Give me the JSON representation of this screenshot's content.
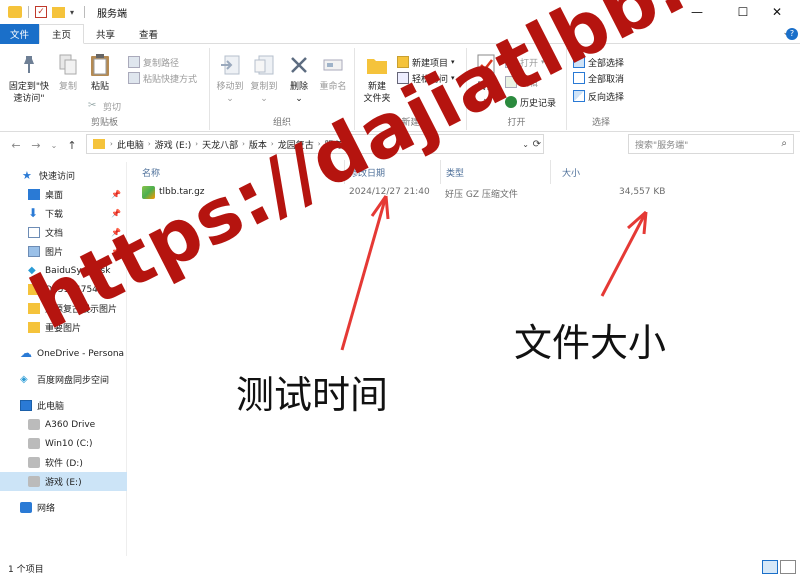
{
  "window": {
    "title": "服务端",
    "controls": {
      "minimize": "—",
      "maximize": "☐",
      "close": "✕"
    }
  },
  "tabs": [
    {
      "label": "文件"
    },
    {
      "label": "主页"
    },
    {
      "label": "共享"
    },
    {
      "label": "查看"
    }
  ],
  "ribbon": {
    "clipboard": {
      "pin_label_1": "固定到\"快",
      "pin_label_2": "速访问\"",
      "copy": "复制",
      "paste": "粘贴",
      "copy_path": "复制路径",
      "paste_shortcut": "粘贴快捷方式",
      "cut": "剪切",
      "group": "剪贴板"
    },
    "organize": {
      "move_to": "移动到",
      "copy_to": "复制到",
      "delete": "删除",
      "rename": "重命名",
      "group": "组织"
    },
    "new": {
      "new_folder_1": "新建",
      "new_folder_2": "文件夹",
      "new_item": "新建项目",
      "easy_access": "轻松访问",
      "group": "新建"
    },
    "open": {
      "properties": "属性",
      "open": "打开",
      "edit": "编辑",
      "history": "历史记录",
      "group": "打开"
    },
    "select": {
      "select_all": "全部选择",
      "select_none": "全部取消",
      "invert": "反向选择",
      "group": "选择"
    }
  },
  "address": {
    "crumbs": [
      "此电脑",
      "游戏 (E:)",
      "天龙八部",
      "版本",
      "龙园复古",
      "服务端"
    ],
    "search_placeholder": "搜索\"服务端\""
  },
  "nav": {
    "items": [
      {
        "label": "快速访问",
        "icon": "star-icon",
        "color": "#2a7ad5"
      },
      {
        "label": "桌面",
        "icon": "desktop-icon",
        "color": "#2a7ad5",
        "pinned": true
      },
      {
        "label": "下载",
        "icon": "download-icon",
        "color": "#2a7ad5",
        "pinned": true
      },
      {
        "label": "文档",
        "icon": "document-icon",
        "color": "#6d8cb5",
        "pinned": true
      },
      {
        "label": "图片",
        "icon": "pictures-icon",
        "color": "#6d8cb5",
        "pinned": true
      },
      {
        "label": "BaiduSyncdisk",
        "icon": "baidu-icon",
        "color": "#2a9bd5"
      },
      {
        "label": "Q251747548",
        "icon": "folder-icon",
        "color": "#f5c33b"
      },
      {
        "label": "龙源复古展示图片",
        "icon": "folder-icon",
        "color": "#f5c33b"
      },
      {
        "label": "重要图片",
        "icon": "folder-icon",
        "color": "#f5c33b"
      },
      {
        "label": "OneDrive - Persona",
        "icon": "cloud-icon",
        "color": "#2a7ad5"
      },
      {
        "label": "百度网盘同步空间",
        "icon": "baidu-icon",
        "color": "#2a9bd5"
      },
      {
        "label": "此电脑",
        "icon": "pc-icon",
        "color": "#2a7ad5"
      },
      {
        "label": "A360 Drive",
        "icon": "drive-icon",
        "color": "#888888"
      },
      {
        "label": "Win10 (C:)",
        "icon": "drive-icon",
        "color": "#888888"
      },
      {
        "label": "软件 (D:)",
        "icon": "drive-icon",
        "color": "#888888"
      },
      {
        "label": "游戏 (E:)",
        "icon": "drive-icon",
        "color": "#888888",
        "selected": true
      },
      {
        "label": "网络",
        "icon": "network-icon",
        "color": "#2a7ad5"
      }
    ]
  },
  "list": {
    "headers": {
      "name": "名称",
      "modified": "修改日期",
      "type": "类型",
      "size": "大小"
    },
    "rows": [
      {
        "name": "tlbb.tar.gz",
        "modified": "2024/12/27 21:40",
        "type": "好压 GZ 压缩文件",
        "size": "34,557 KB"
      }
    ]
  },
  "status": {
    "count": "1 个项目"
  },
  "annotations": {
    "size_note": "文件大小",
    "time_note": "测试时间",
    "watermark": "https://dajiatlbb.com/"
  }
}
